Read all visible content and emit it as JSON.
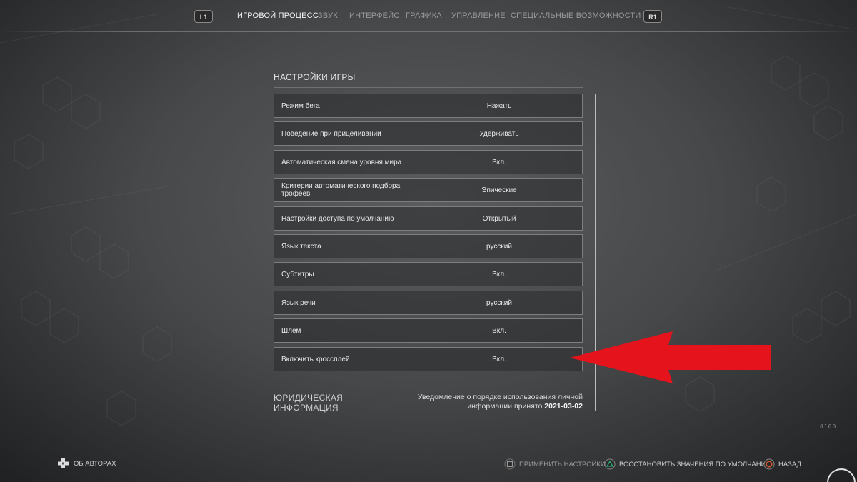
{
  "nav": {
    "left_shoulder": "L1",
    "right_shoulder": "R1",
    "tabs": [
      {
        "label": "ИГРОВОЙ ПРОЦЕСС",
        "active": true
      },
      {
        "label": "ЗВУК",
        "active": false
      },
      {
        "label": "ИНТЕРФЕЙС",
        "active": false
      },
      {
        "label": "ГРАФИКА",
        "active": false
      },
      {
        "label": "УПРАВЛЕНИЕ",
        "active": false
      },
      {
        "label": "СПЕЦИАЛЬНЫЕ ВОЗМОЖНОСТИ",
        "active": false
      }
    ]
  },
  "settings": {
    "title": "НАСТРОЙКИ ИГРЫ",
    "rows": [
      {
        "label": "Режим бега",
        "value": "Нажать"
      },
      {
        "label": "Поведение при прицеливании",
        "value": "Удерживать"
      },
      {
        "label": "Автоматическая смена уровня мира",
        "value": "Вкл."
      },
      {
        "label": "Критерии автоматического подбора трофеев",
        "value": "Эпические"
      },
      {
        "label": "Настройки доступа по умолчанию",
        "value": "Открытый"
      },
      {
        "label": "Язык текста",
        "value": "русский"
      },
      {
        "label": "Субтитры",
        "value": "Вкл."
      },
      {
        "label": "Язык речи",
        "value": "русский"
      },
      {
        "label": "Шлем",
        "value": "Вкл."
      },
      {
        "label": "Включить кроссплей",
        "value": "Вкл."
      }
    ]
  },
  "legal": {
    "title": "ЮРИДИЧЕСКАЯ ИНФОРМАЦИЯ",
    "notice": "Уведомление о порядке использования личной информации принято",
    "date": "2021-03-02"
  },
  "footer": {
    "credits": "ОБ АВТОРАХ",
    "apply": "ПРИМЕНИТЬ НАСТРОЙКИ",
    "restore": "ВОССТАНОВИТЬ ЗНАЧЕНИЯ ПО УМОЛЧАНИЮ",
    "back": "НАЗАД"
  },
  "version": "0100",
  "colors": {
    "arrow": "#e5141c",
    "accent_green": "#2fae7a",
    "accent_orange": "#e2562d"
  },
  "icons": {
    "credits": "dpad-icon",
    "apply": "square-button-icon",
    "restore": "triangle-button-icon",
    "back": "circle-button-icon"
  }
}
